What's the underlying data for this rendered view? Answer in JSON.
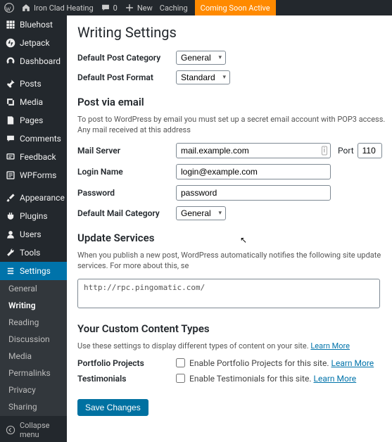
{
  "topbar": {
    "site_name": "Iron Clad Heating",
    "comments_count": "0",
    "new_label": "New",
    "caching_label": "Caching",
    "coming_soon": "Coming Soon Active"
  },
  "sidebar": {
    "items": [
      {
        "label": "Bluehost",
        "icon": "bluehost"
      },
      {
        "label": "Jetpack",
        "icon": "jetpack"
      },
      {
        "label": "Dashboard",
        "icon": "dashboard"
      },
      {
        "label": "Posts",
        "icon": "posts"
      },
      {
        "label": "Media",
        "icon": "media"
      },
      {
        "label": "Pages",
        "icon": "pages"
      },
      {
        "label": "Comments",
        "icon": "comments"
      },
      {
        "label": "Feedback",
        "icon": "feedback"
      },
      {
        "label": "WPForms",
        "icon": "wpforms"
      },
      {
        "label": "Appearance",
        "icon": "appearance"
      },
      {
        "label": "Plugins",
        "icon": "plugins"
      },
      {
        "label": "Users",
        "icon": "users"
      },
      {
        "label": "Tools",
        "icon": "tools"
      },
      {
        "label": "Settings",
        "icon": "settings"
      }
    ],
    "submenu": [
      {
        "label": "General"
      },
      {
        "label": "Writing",
        "active": true
      },
      {
        "label": "Reading"
      },
      {
        "label": "Discussion"
      },
      {
        "label": "Media"
      },
      {
        "label": "Permalinks"
      },
      {
        "label": "Privacy"
      },
      {
        "label": "Sharing"
      }
    ],
    "collapse_label": "Collapse menu"
  },
  "page": {
    "title": "Writing Settings",
    "default_category_label": "Default Post Category",
    "default_category_value": "General",
    "default_format_label": "Default Post Format",
    "default_format_value": "Standard",
    "post_via_email": {
      "heading": "Post via email",
      "description": "To post to WordPress by email you must set up a secret email account with POP3 access. Any mail received at this address",
      "mail_server_label": "Mail Server",
      "mail_server_value": "mail.example.com",
      "port_label": "Port",
      "port_value": "110",
      "login_label": "Login Name",
      "login_value": "login@example.com",
      "password_label": "Password",
      "password_value": "password",
      "default_mail_cat_label": "Default Mail Category",
      "default_mail_cat_value": "General"
    },
    "update_services": {
      "heading": "Update Services",
      "description": "When you publish a new post, WordPress automatically notifies the following site update services. For more about this, se",
      "value": "http://rpc.pingomatic.com/"
    },
    "custom_types": {
      "heading": "Your Custom Content Types",
      "description": "Use these settings to display different types of content on your site.",
      "learn_more": "Learn More",
      "portfolio_label": "Portfolio Projects",
      "portfolio_cbx": "Enable Portfolio Projects for this site.",
      "testimonials_label": "Testimonials",
      "testimonials_cbx": "Enable Testimonials for this site."
    },
    "save_label": "Save Changes"
  }
}
